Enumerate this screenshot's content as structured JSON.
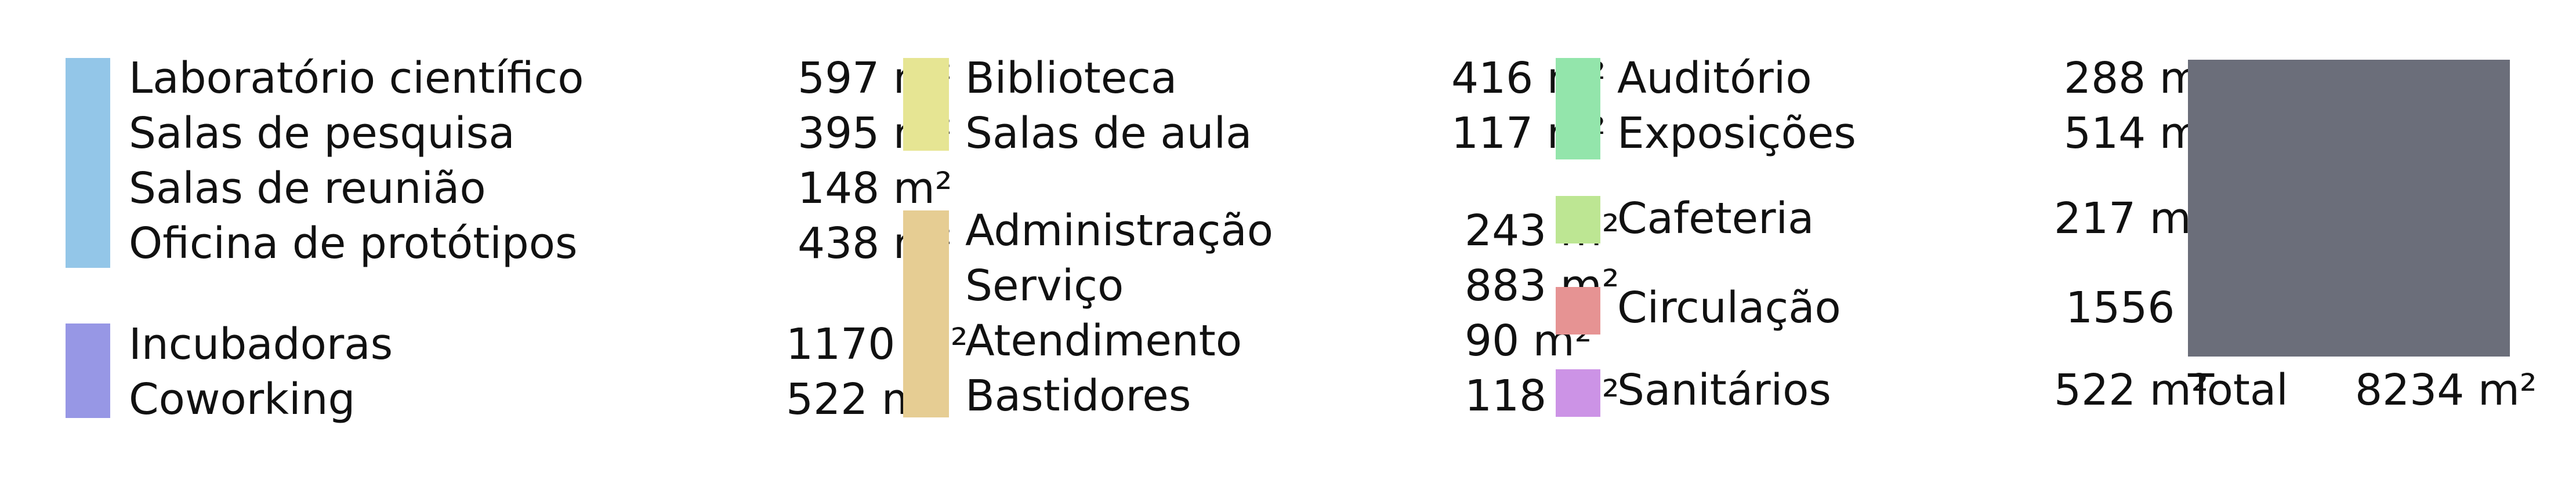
{
  "unit": "m²",
  "groups": [
    {
      "id": "research",
      "color": "#93c6e8",
      "items": [
        {
          "label": "Laboratório científico",
          "value": "597 m²"
        },
        {
          "label": "Salas de pesquisa",
          "value": "395 m²"
        },
        {
          "label": "Salas de reunião",
          "value": "148 m²"
        },
        {
          "label": "Oficina de protótipos",
          "value": "438 m²"
        }
      ]
    },
    {
      "id": "incubation",
      "color": "#9797e5",
      "items": [
        {
          "label": "Incubadoras",
          "value": "1170 m²"
        },
        {
          "label": "Coworking",
          "value": "522 m²"
        }
      ]
    },
    {
      "id": "learning",
      "color": "#e6e593",
      "items": [
        {
          "label": "Biblioteca",
          "value": "416 m²"
        },
        {
          "label": "Salas de aula",
          "value": "117 m²"
        }
      ]
    },
    {
      "id": "operations",
      "color": "#e6cd93",
      "items": [
        {
          "label": "Administração",
          "value": "243 m²"
        },
        {
          "label": "Serviço",
          "value": "883 m²"
        },
        {
          "label": "Atendimento",
          "value": "90 m²"
        },
        {
          "label": "Bastidores",
          "value": "118 m²"
        }
      ]
    },
    {
      "id": "public",
      "color": "#93e5ab",
      "items": [
        {
          "label": "Auditório",
          "value": "288 m²"
        },
        {
          "label": "Exposições",
          "value": "514 m²"
        }
      ]
    },
    {
      "id": "cafe",
      "color": "#bde693",
      "items": [
        {
          "label": "Cafeteria",
          "value": "217 m²"
        }
      ]
    },
    {
      "id": "circulation",
      "color": "#e69393",
      "items": [
        {
          "label": "Circulação",
          "value": "1556 m²"
        }
      ]
    },
    {
      "id": "restrooms",
      "color": "#cc93e6",
      "items": [
        {
          "label": "Sanitários",
          "value": "522 m²"
        }
      ]
    }
  ],
  "total": {
    "label": "Total",
    "value": "8234 m²",
    "color": "#6b6e7a"
  }
}
